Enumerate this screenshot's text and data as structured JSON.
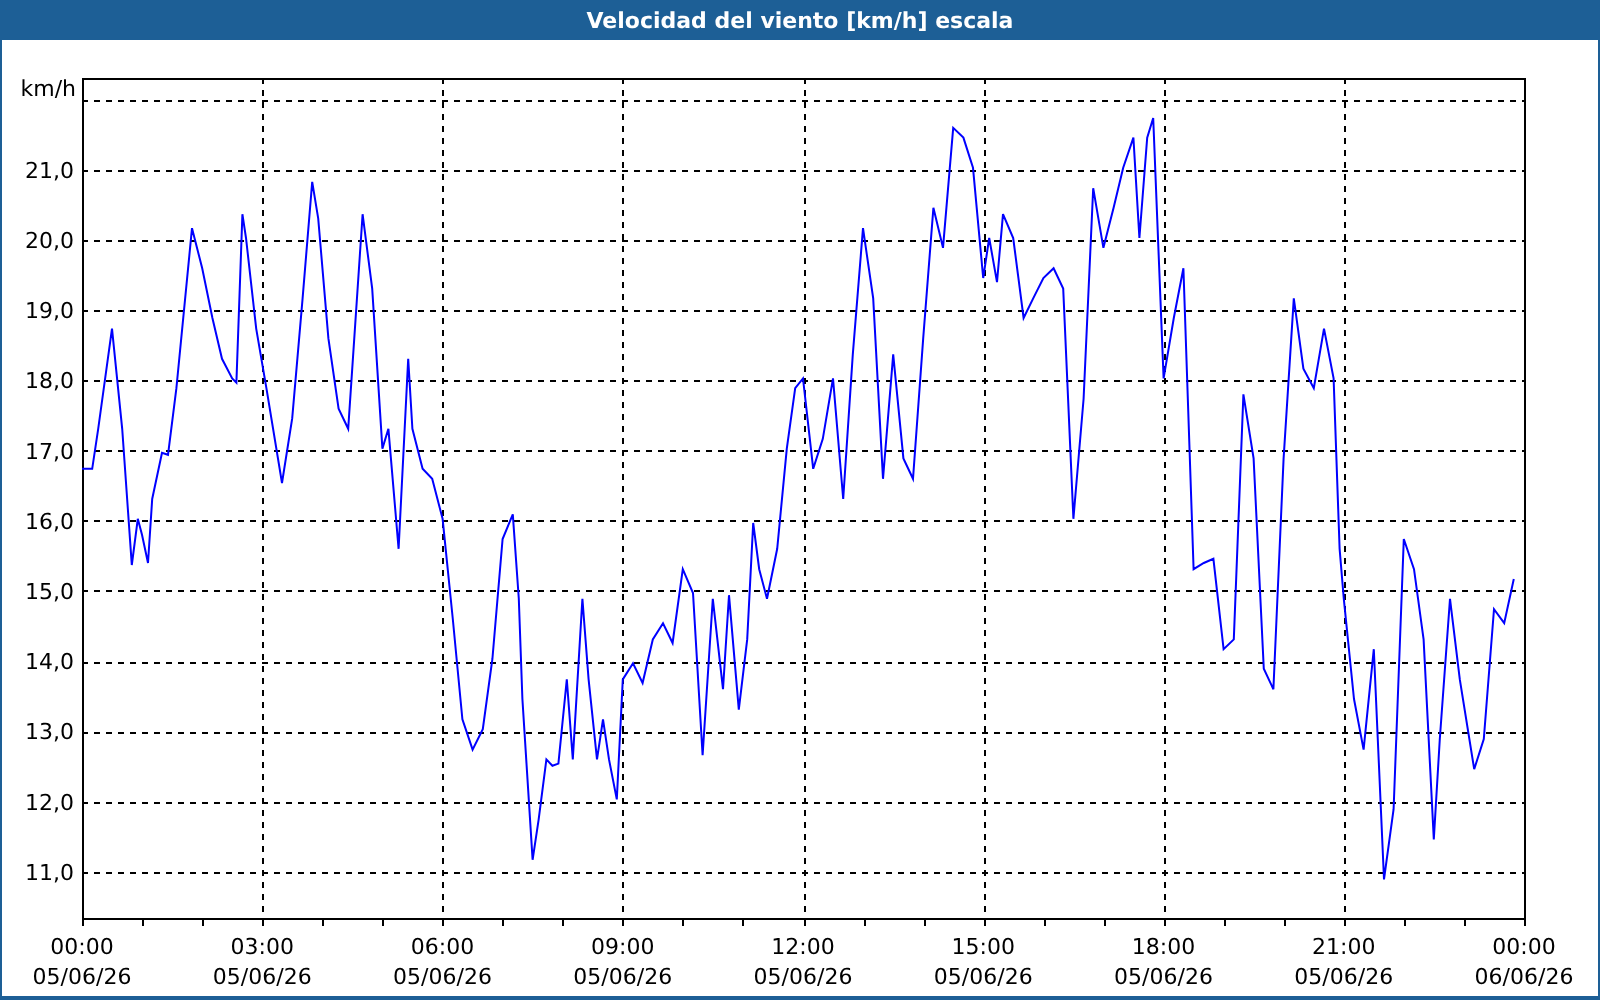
{
  "window": {
    "title": "Velocidad del viento [km/h] escala"
  },
  "chart_data": {
    "type": "line",
    "grid": true,
    "ylabel": "km/h",
    "xlim": [
      0,
      24
    ],
    "ylim": [
      10.34,
      22.31
    ],
    "xticks": [
      {
        "value": 0,
        "label": "00:00"
      },
      {
        "value": 3,
        "label": "03:00"
      },
      {
        "value": 6,
        "label": "06:00"
      },
      {
        "value": 9,
        "label": "09:00"
      },
      {
        "value": 12,
        "label": "12:00"
      },
      {
        "value": 15,
        "label": "15:00"
      },
      {
        "value": 18,
        "label": "18:00"
      },
      {
        "value": 21,
        "label": "21:00"
      },
      {
        "value": 24,
        "label": "00:00"
      }
    ],
    "annotations": [
      "05/06/26",
      "05/06/26",
      "05/06/26",
      "05/06/26",
      "05/06/26",
      "05/06/26",
      "05/06/26",
      "05/06/26",
      "06/06/26"
    ],
    "yticks": [
      {
        "value": 11,
        "label": "11,0"
      },
      {
        "value": 12,
        "label": "12,0"
      },
      {
        "value": 13,
        "label": "13,0"
      },
      {
        "value": 14,
        "label": "14,0"
      },
      {
        "value": 15,
        "label": "15,0"
      },
      {
        "value": 16,
        "label": "16,0"
      },
      {
        "value": 17,
        "label": "17,0"
      },
      {
        "value": 18,
        "label": "18,0"
      },
      {
        "value": 19,
        "label": "19,0"
      },
      {
        "value": 20,
        "label": "20,0"
      },
      {
        "value": 21,
        "label": "21,0"
      }
    ],
    "x": [
      0,
      0.17,
      0.27,
      0.5,
      0.67,
      0.83,
      0.93,
      1.0,
      1.1,
      1.17,
      1.33,
      1.43,
      1.57,
      1.83,
      2.0,
      2.17,
      2.33,
      2.5,
      2.57,
      2.67,
      2.73,
      2.9,
      3.07,
      3.33,
      3.5,
      3.67,
      3.83,
      3.93,
      4.1,
      4.27,
      4.43,
      4.67,
      4.83,
      5.0,
      5.1,
      5.27,
      5.43,
      5.5,
      5.67,
      5.83,
      6.0,
      6.17,
      6.33,
      6.5,
      6.67,
      6.83,
      7.0,
      7.17,
      7.27,
      7.33,
      7.5,
      7.6,
      7.73,
      7.83,
      7.93,
      8.07,
      8.17,
      8.33,
      8.43,
      8.57,
      8.67,
      8.77,
      8.9,
      9.0,
      9.17,
      9.33,
      9.5,
      9.67,
      9.83,
      10.0,
      10.17,
      10.33,
      10.5,
      10.67,
      10.77,
      10.93,
      11.07,
      11.17,
      11.27,
      11.4,
      11.57,
      11.73,
      11.87,
      12.0,
      12.17,
      12.33,
      12.5,
      12.67,
      12.83,
      13.0,
      13.17,
      13.33,
      13.5,
      13.67,
      13.83,
      14.0,
      14.17,
      14.33,
      14.5,
      14.67,
      14.83,
      15.0,
      15.1,
      15.23,
      15.33,
      15.5,
      15.67,
      15.83,
      16.0,
      16.17,
      16.33,
      16.5,
      16.67,
      16.83,
      17.0,
      17.17,
      17.33,
      17.5,
      17.6,
      17.73,
      17.83,
      18.0,
      18.17,
      18.33,
      18.5,
      18.67,
      18.83,
      19.0,
      19.17,
      19.33,
      19.5,
      19.67,
      19.83,
      20.0,
      20.17,
      20.33,
      20.5,
      20.67,
      20.83,
      20.93,
      21.0,
      21.17,
      21.33,
      21.5,
      21.67,
      21.83,
      22.0,
      22.17,
      22.33,
      22.5,
      22.6,
      22.77,
      22.93,
      23.17,
      23.33,
      23.5,
      23.67,
      23.83
    ],
    "series": [
      {
        "color": "#0000ff",
        "values": [
          16.74,
          16.74,
          17.31,
          18.74,
          17.31,
          15.37,
          16.03,
          15.8,
          15.4,
          16.31,
          16.97,
          16.94,
          17.89,
          20.17,
          19.6,
          18.89,
          18.31,
          18.03,
          17.97,
          20.37,
          20.03,
          18.74,
          17.89,
          16.54,
          17.46,
          19.17,
          20.83,
          20.31,
          18.6,
          17.6,
          17.31,
          20.37,
          19.31,
          17.03,
          17.31,
          15.6,
          18.31,
          17.31,
          16.74,
          16.6,
          16.03,
          14.6,
          13.17,
          12.74,
          13.03,
          14.03,
          15.74,
          16.09,
          14.89,
          13.46,
          11.17,
          11.74,
          12.6,
          12.51,
          12.54,
          13.74,
          12.6,
          14.89,
          13.74,
          12.6,
          13.17,
          12.6,
          12.03,
          13.74,
          13.97,
          13.69,
          14.31,
          14.54,
          14.26,
          15.31,
          14.97,
          12.66,
          14.89,
          13.6,
          14.94,
          13.31,
          14.31,
          15.97,
          15.31,
          14.89,
          15.6,
          17.03,
          17.89,
          18.03,
          16.74,
          17.17,
          18.03,
          16.31,
          18.37,
          20.17,
          19.17,
          16.6,
          18.37,
          16.89,
          16.6,
          18.6,
          20.46,
          19.89,
          21.6,
          21.46,
          21.03,
          19.46,
          20.03,
          19.4,
          20.37,
          20.03,
          18.89,
          19.17,
          19.46,
          19.6,
          19.31,
          16.03,
          17.74,
          20.74,
          19.89,
          20.46,
          21.03,
          21.46,
          20.03,
          21.46,
          21.74,
          18.03,
          18.89,
          19.6,
          15.31,
          15.4,
          15.46,
          14.17,
          14.31,
          17.8,
          16.89,
          13.89,
          13.6,
          16.89,
          19.17,
          18.17,
          17.89,
          18.74,
          18.03,
          15.6,
          14.89,
          13.46,
          12.74,
          14.17,
          10.89,
          11.89,
          15.74,
          15.31,
          14.31,
          11.46,
          12.89,
          14.89,
          13.74,
          12.46,
          12.89,
          14.74,
          14.54,
          15.17
        ]
      }
    ]
  }
}
